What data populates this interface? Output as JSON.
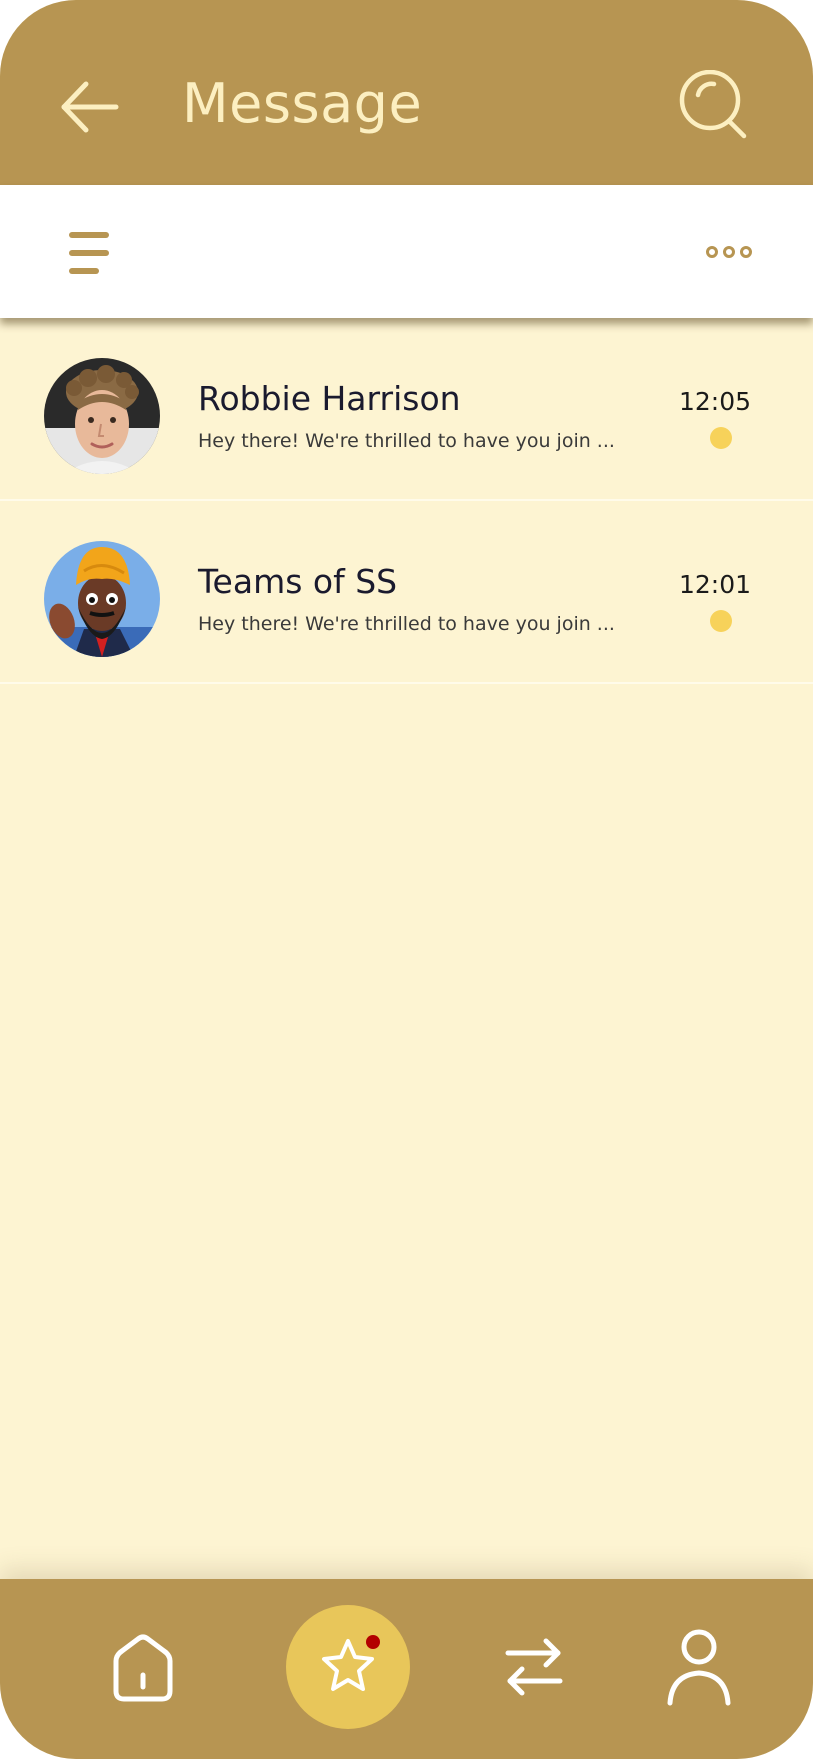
{
  "header": {
    "title": "Message",
    "back_icon": "arrow-left-icon",
    "search_icon": "search-icon"
  },
  "toolbar": {
    "menu_icon": "menu-icon",
    "more_icon": "more-horizontal-icon"
  },
  "conversations": [
    {
      "name": "Robbie Harrison",
      "preview": "Hey there! We're thrilled to have you join ...",
      "time": "12:05",
      "unread": true,
      "avatar": "photo-avatar"
    },
    {
      "name": "Teams of SS",
      "preview": "Hey there! We're thrilled to have you join ...",
      "time": "12:01",
      "unread": true,
      "avatar": "cartoon-avatar"
    }
  ],
  "bottom_nav": {
    "items": [
      "home-icon",
      "star-icon",
      "transfer-icon",
      "profile-icon"
    ],
    "active": "star-icon",
    "notification": true
  },
  "colors": {
    "primary": "#B79552",
    "header_text": "#FCEFC1",
    "background": "#FDF4D2",
    "unread_dot": "#F7D25A",
    "active_nav": "#E8C65A",
    "notification_dot": "#B30000"
  }
}
